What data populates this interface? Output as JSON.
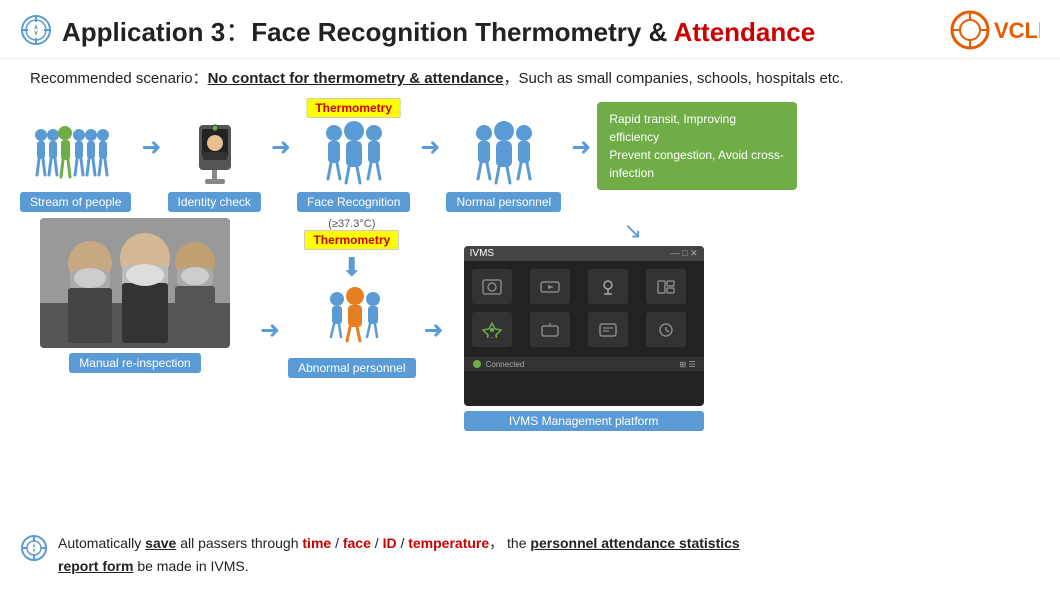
{
  "header": {
    "title_part1": "Application 3",
    "colon": "：",
    "title_part2": "Face Recognition Thermometry & ",
    "title_accent": "Attendance",
    "logo": "VCLEY"
  },
  "subheader": {
    "prefix": "Recommended scenario：",
    "underlined": "No contact for thermometry & attendance",
    "suffix": "，Such as small companies, schools, hospitals etc."
  },
  "flow": {
    "items": [
      {
        "label": "Stream of people"
      },
      {
        "label": "Identity check"
      },
      {
        "label": "Face Recognition"
      },
      {
        "label": "Normal personnel"
      }
    ],
    "thermometry_badge": "Thermometry",
    "green_box_line1": "Rapid transit, Improving efficiency",
    "green_box_line2": "Prevent congestion, Avoid cross-infection",
    "temp_threshold": "(≥37.3°C)",
    "thermometry_badge2": "Thermometry",
    "abnormal_label": "Abnormal personnel",
    "manual_label": "Manual re-inspection",
    "ivms_header_left": "IVMS",
    "ivms_label": "IVMS Management platform"
  },
  "footer": {
    "text_before": "Automatically ",
    "save_bold": "save",
    "text_middle1": " all passers through ",
    "time_red": "time",
    "slash1": " / ",
    "face_red": "face",
    "slash2": " / ",
    "id_red": "ID",
    "slash3": " / ",
    "temp_red": "temperature",
    "comma": "，  the ",
    "stats_underline": "the personnel attendance statistics",
    "report_underline": "report form",
    "text_end": " be made in IVMS."
  }
}
